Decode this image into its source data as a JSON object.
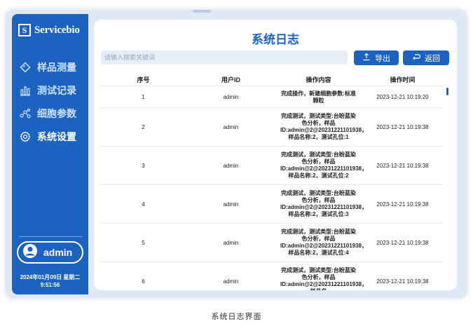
{
  "app": {
    "logo_mark": "S",
    "logo_text": "Servicebio"
  },
  "sidebar": {
    "items": [
      {
        "label": "样品测量",
        "icon": "diamond-tag-icon"
      },
      {
        "label": "测试记录",
        "icon": "bar-chart-icon"
      },
      {
        "label": "细胞参数",
        "icon": "network-nodes-icon"
      },
      {
        "label": "系统设置",
        "icon": "gear-icon",
        "active": true
      }
    ],
    "user": {
      "name": "admin",
      "icon": "user-circle-icon"
    },
    "date": "2024年01月09日 星期二",
    "time": "9:51:56"
  },
  "main": {
    "title": "系统日志",
    "search_placeholder": "请输入搜索关键词",
    "export_label": "导出",
    "back_label": "返回",
    "columns": [
      "序号",
      "用户ID",
      "操作内容",
      "操作时间"
    ],
    "rows": [
      {
        "no": "1",
        "user": "admin",
        "content": "完成操作，新建细胞参数:标准颗粒",
        "time": "2023-12-21 10:19:20"
      },
      {
        "no": "2",
        "user": "admin",
        "content": "完成测试，测试类型:台盼蓝染色分析，样品ID:admin@2@20231221101938，样品名称:2，测试孔位:1",
        "time": "2023-12-21 10:19:38"
      },
      {
        "no": "3",
        "user": "admin",
        "content": "完成测试，测试类型:台盼蓝染色分析，样品ID:admin@2@20231221101938，样品名称:2，测试孔位:2",
        "time": "2023-12-21 10:19:38"
      },
      {
        "no": "4",
        "user": "admin",
        "content": "完成测试，测试类型:台盼蓝染色分析，样品ID:admin@2@20231221101938，样品名称:2，测试孔位:3",
        "time": "2023-12-21 10:19:38"
      },
      {
        "no": "5",
        "user": "admin",
        "content": "完成测试，测试类型:台盼蓝染色分析，样品ID:admin@2@20231221101938，样品名称:2，测试孔位:4",
        "time": "2023-12-21 10:19:38"
      },
      {
        "no": "6",
        "user": "admin",
        "content": "完成测试，测试类型:台盼蓝染色分析，样品ID:admin@2@20231221101938，样品名",
        "time": "2023-12-21 10:19:38"
      }
    ]
  },
  "caption": "系统日志界面",
  "colors": {
    "primary": "#1c63c0",
    "frame": "#dfe9f6",
    "search_bg": "#e6edf7"
  }
}
